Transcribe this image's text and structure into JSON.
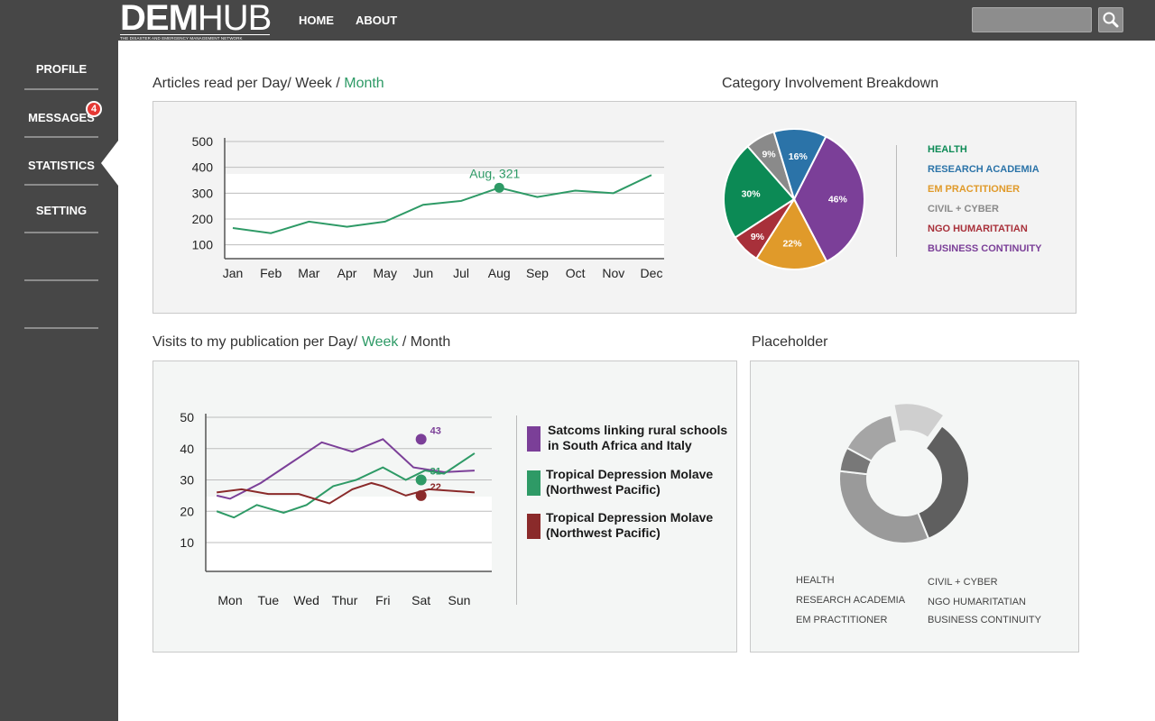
{
  "app": {
    "logo": "DEMHUB",
    "logo_bold": "DEM",
    "logo_light": "HUB",
    "tagline": "THE DISASTER AND EMERGENCY MANAGEMENT NETWORK"
  },
  "topnav": {
    "home": "HOME",
    "about": "ABOUT",
    "search_value": ""
  },
  "sidebar": {
    "items": [
      {
        "label": "PROFILE"
      },
      {
        "label": "MESSAGES",
        "badge": "4"
      },
      {
        "label": "STATISTICS",
        "active": true
      },
      {
        "label": "SETTING"
      }
    ]
  },
  "articles": {
    "title_prefix": "Articles read per Day/ Week / ",
    "title_highlight": "Month",
    "chart_data": {
      "type": "line",
      "categories": [
        "Jan",
        "Feb",
        "Mar",
        "Apr",
        "May",
        "Jun",
        "Jul",
        "Aug",
        "Sep",
        "Oct",
        "Nov",
        "Dec"
      ],
      "values": [
        165,
        145,
        190,
        170,
        190,
        255,
        270,
        321,
        285,
        310,
        300,
        370
      ],
      "ylim": [
        0,
        500
      ],
      "yticks": [
        100,
        200,
        300,
        400,
        500
      ],
      "annotation": {
        "label": "Aug, 321",
        "index": 7
      },
      "color": "#2e9a66"
    }
  },
  "category": {
    "title": "Category Involvement Breakdown",
    "chart_data": {
      "type": "pie",
      "slices": [
        {
          "name": "BUSINESS CONTINUITY",
          "value": 46,
          "color": "#7b3f98",
          "label": "46%"
        },
        {
          "name": "EM PRACTITIONER",
          "value": 22,
          "color": "#e09a2a",
          "label": "22%"
        },
        {
          "name": "NGO HUMARITATIAN",
          "value": 9,
          "color": "#a8303a",
          "label": "9%"
        },
        {
          "name": "HEALTH",
          "value": 30,
          "color": "#0c8a55",
          "label": "30%"
        },
        {
          "name": "CIVIL + CYBER",
          "value": 9,
          "color": "#8a8a8a",
          "label": "9%"
        },
        {
          "name": "RESEARCH ACADEMIA",
          "value": 16,
          "color": "#2b73a8",
          "label": "16%"
        }
      ]
    },
    "legend": [
      {
        "label": "HEALTH",
        "color": "#0c8a55"
      },
      {
        "label": "RESEARCH ACADEMIA",
        "color": "#2b73a8"
      },
      {
        "label": "EM PRACTITIONER",
        "color": "#e09a2a"
      },
      {
        "label": "CIVIL + CYBER",
        "color": "#8a8a8a"
      },
      {
        "label": "NGO HUMARITATIAN",
        "color": "#a8303a"
      },
      {
        "label": "BUSINESS CONTINUITY",
        "color": "#7b3f98"
      }
    ]
  },
  "visits": {
    "title_prefix": "Visits to my publication per Day/ ",
    "title_highlight": "Week",
    "title_suffix": " / Month",
    "chart_data": {
      "type": "line",
      "categories": [
        "Mon",
        "Tue",
        "Wed",
        "Thur",
        "Fri",
        "Sat",
        "Sun"
      ],
      "yticks": [
        10,
        20,
        30,
        40,
        50
      ],
      "series": [
        {
          "name": "Satcoms linking rural schools in South Africa and Italy",
          "color": "#7b3f98",
          "line1": "Satcoms linking rural schools",
          "line2": "in South Africa and Italy",
          "x": [
            -0.35,
            0,
            0.8,
            1.6,
            2.4,
            3.2,
            4.0,
            4.8,
            5.6,
            6.4,
            6.8
          ],
          "y": [
            25,
            24,
            29,
            35.5,
            42,
            39,
            43,
            34,
            32.5,
            33,
            null
          ],
          "marker_index": 6,
          "marker_label": "43"
        },
        {
          "name": "Tropical Depression Molave (Northwest Pacific)",
          "color": "#2e9a66",
          "line1": "Tropical Depression Molave",
          "line2": "(Northwest Pacific)",
          "x": [
            -0.35,
            0.1,
            0.7,
            1.4,
            2.0,
            2.7,
            3.3,
            4.0,
            4.6,
            5.1,
            5.6,
            6.4,
            6.8
          ],
          "y": [
            20,
            18,
            22,
            19.5,
            22,
            28,
            30,
            34,
            30,
            33,
            32,
            38.5,
            null
          ],
          "marker_index": 8,
          "marker_label": "31"
        },
        {
          "name": "Tropical Depression Molave (Northwest Pacific)",
          "color": "#8a2a2a",
          "line1": "Tropical Depression Molave",
          "line2": "(Northwest Pacific)",
          "x": [
            -0.35,
            0.3,
            1.0,
            1.8,
            2.6,
            3.2,
            3.7,
            4.0,
            4.6,
            5.2,
            5.8,
            6.4
          ],
          "y": [
            26,
            27,
            25.5,
            25.5,
            22.5,
            27,
            29,
            28,
            25,
            27,
            26.5,
            26
          ],
          "marker_index": 8,
          "marker_label": "22"
        }
      ]
    }
  },
  "placeholder": {
    "title": "Placeholder",
    "chart_data": {
      "type": "pie",
      "slices": [
        {
          "name": "HEALTH",
          "value": 34,
          "color": "#5f5f5f"
        },
        {
          "name": "RESEARCH ACADEMIA",
          "value": 33,
          "color": "#9a9a9a"
        },
        {
          "name": "EM PRACTITIONER",
          "value": 6,
          "color": "#787878"
        },
        {
          "name": "CIVIL + CYBER",
          "value": 14,
          "color": "#a5a5a5"
        },
        {
          "name": "NGO HUMARITATIAN",
          "value": 13,
          "color": "#cfcfcf"
        }
      ]
    },
    "legend_left": [
      "HEALTH",
      "RESEARCH ACADEMIA",
      "EM PRACTITIONER"
    ],
    "legend_right": [
      "CIVIL + CYBER",
      "NGO HUMARITATIAN",
      "BUSINESS CONTINUITY"
    ]
  }
}
